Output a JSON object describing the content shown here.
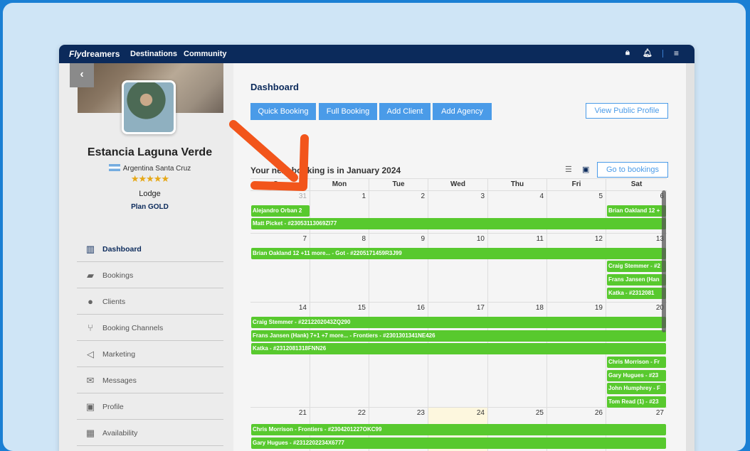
{
  "topbar": {
    "logo_a": "Fly",
    "logo_b": "dreamers",
    "nav": [
      "Destinations",
      "Community"
    ]
  },
  "profile": {
    "name": "Estancia Laguna Verde",
    "location": "Argentina Santa Cruz",
    "stars": "★★★★★",
    "type": "Lodge",
    "plan": "Plan GOLD"
  },
  "menu": [
    {
      "label": "Dashboard",
      "icon": "▥"
    },
    {
      "label": "Bookings",
      "icon": "▰"
    },
    {
      "label": "Clients",
      "icon": "●"
    },
    {
      "label": "Booking Channels",
      "icon": "⑂"
    },
    {
      "label": "Marketing",
      "icon": "◁"
    },
    {
      "label": "Messages",
      "icon": "✉"
    },
    {
      "label": "Profile",
      "icon": "▣"
    },
    {
      "label": "Availability",
      "icon": "▦"
    }
  ],
  "dashboard": {
    "title": "Dashboard",
    "buttons": [
      "Quick Booking",
      "Full Booking",
      "Add Client",
      "Add Agency"
    ],
    "view_public": "View Public Profile",
    "next_booking": "Your next booking is in January 2024",
    "go_bookings": "Go to bookings"
  },
  "calendar": {
    "days": [
      "Sun",
      "Mon",
      "Tue",
      "Wed",
      "Thu",
      "Fri",
      "Sat"
    ],
    "weeks": [
      [
        "31",
        "1",
        "2",
        "3",
        "4",
        "5",
        "6"
      ],
      [
        "7",
        "8",
        "9",
        "10",
        "11",
        "12",
        "13"
      ],
      [
        "14",
        "15",
        "16",
        "17",
        "18",
        "19",
        "20"
      ],
      [
        "21",
        "22",
        "23",
        "24",
        "25",
        "26",
        "27"
      ]
    ],
    "events": [
      "Alejandro Orban 2",
      "Brian Oakland 12 +",
      "Matt Picket - #23053113069ZI77",
      "Brian Oakland 12 +11 more... - Got - #2205171459R3J99",
      "Craig Stemmer - #2",
      "Frans Jansen (Han",
      "Katka - #2312081",
      "Craig Stemmer - #2212202043ZQ290",
      "Frans Jansen (Hank) 7+1 +7 more... - Frontiers - #2301301341NE426",
      "Katka - #2312081318FNN26",
      "Chris Morrison - Fr",
      "Gary Hugues - #23",
      "John Humphrey - F",
      "Tom Read (1) - #23",
      "Chris Morrison - Frontiers - #2304201227OKC99",
      "Gary Hugues - #2312202234X6777"
    ]
  },
  "colors": {
    "navy": "#0b2a5b",
    "blue": "#4a9be8",
    "event": "#58c92e",
    "arrow": "#f2551b"
  }
}
